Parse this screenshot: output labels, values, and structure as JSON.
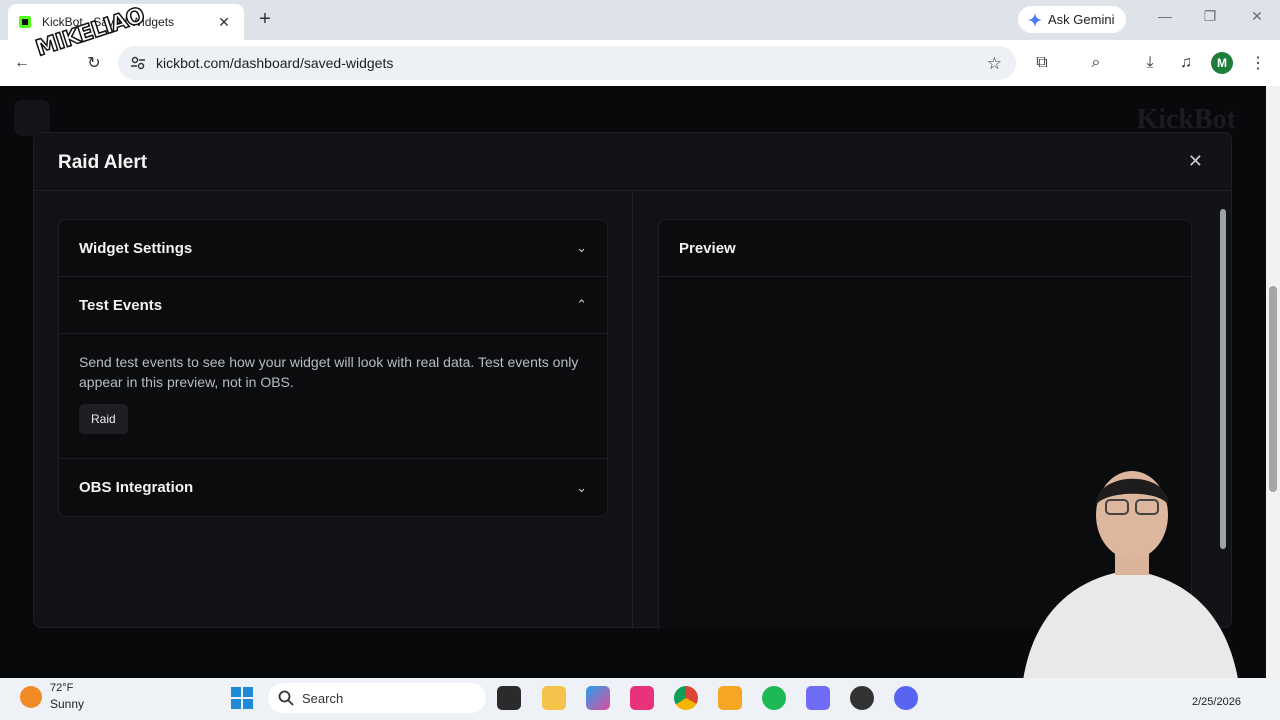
{
  "browser": {
    "tab_title": "KickBot - Saved Widgets",
    "url": "kickbot.com/dashboard/saved-widgets",
    "gemini_label": "Ask Gemini",
    "profile_initial": "M"
  },
  "watermark": "MIKELIAO",
  "page": {
    "bg_logo": "KickBot"
  },
  "modal": {
    "title": "Raid Alert",
    "sections": {
      "widget_settings": "Widget Settings",
      "test_events": "Test Events",
      "test_events_desc": "Send test events to see how your widget will look with real data. Test events only appear in this preview, not in OBS.",
      "raid_button": "Raid",
      "obs_integration": "OBS Integration"
    },
    "preview_title": "Preview"
  },
  "taskbar": {
    "temperature": "72°F",
    "condition": "Sunny",
    "search_placeholder": "Search",
    "date": "2/25/2026"
  },
  "colors": {
    "modal_bg": "#121316",
    "panel_bg": "#0b0c0e",
    "accent_avatar": "#1e7d3a"
  }
}
